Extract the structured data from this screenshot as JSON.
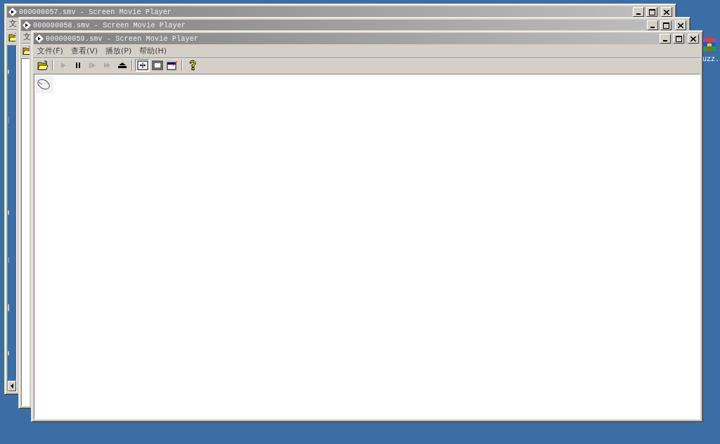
{
  "desktop": {
    "icon_label": "uzz."
  },
  "windows": [
    {
      "title": "000000057.smv - Screen Movie Player",
      "menu": [
        "文"
      ],
      "toolbar_groups": [
        [
          {
            "disabled": false,
            "pressed": false
          }
        ]
      ],
      "content": {
        "kind": "video"
      },
      "scrollbar": true
    },
    {
      "title": "000000058.smv - Screen Movie Player",
      "menu": [
        "文"
      ],
      "toolbar_groups": [
        [
          {
            "disabled": false,
            "pressed": false
          }
        ]
      ],
      "content": {
        "kind": "blank"
      },
      "scrollbar": false
    },
    {
      "title": "000000059.smv - Screen Movie Player",
      "menu": [
        "文件(F)",
        "查看(V)",
        "播放(P)",
        "帮助(H)"
      ],
      "toolbar_groups": [
        [
          {
            "disabled": false,
            "pressed": false
          }
        ],
        [
          {
            "disabled": true,
            "pressed": false
          },
          {
            "disabled": false,
            "pressed": false
          },
          {
            "disabled": true,
            "pressed": false
          },
          {
            "disabled": true,
            "pressed": false
          },
          {
            "disabled": false,
            "pressed": false
          }
        ],
        [
          {
            "disabled": false,
            "pressed": true
          },
          {
            "disabled": false,
            "pressed": false
          },
          {
            "disabled": false,
            "pressed": false
          }
        ],
        [
          {
            "disabled": false,
            "pressed": false
          }
        ]
      ],
      "content": {
        "kind": "blank-cursor"
      },
      "scrollbar": false
    }
  ]
}
